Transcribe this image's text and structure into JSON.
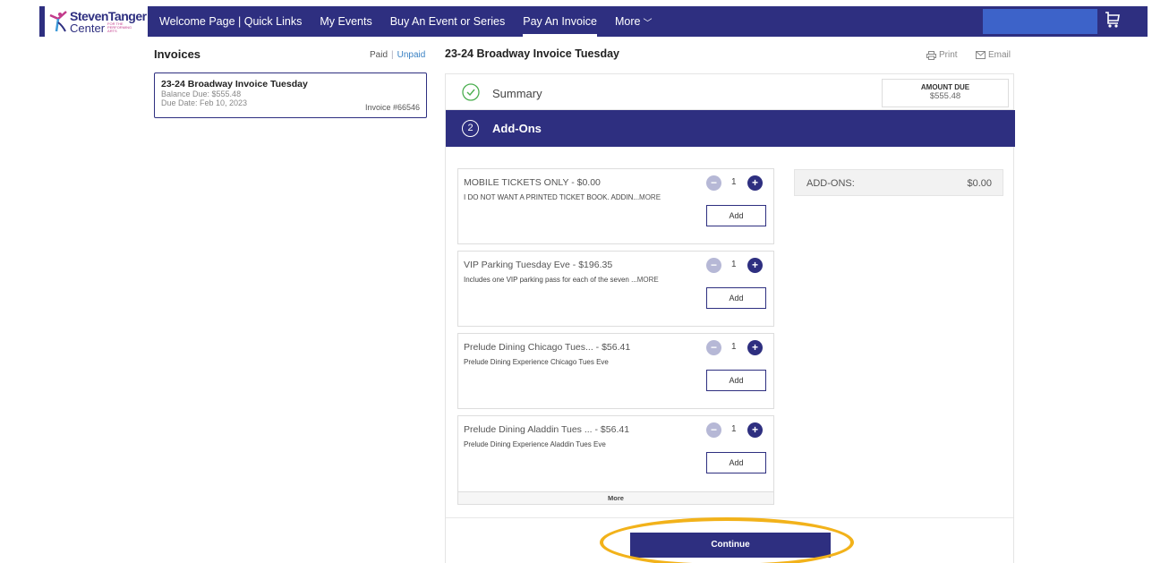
{
  "logo": {
    "line1": "StevenTanger",
    "line2": "Center",
    "tagline": "FOR THE PERFORMING ARTS"
  },
  "nav": {
    "items": [
      {
        "label": "Welcome Page | Quick Links"
      },
      {
        "label": "My Events"
      },
      {
        "label": "Buy An Event or Series"
      },
      {
        "label": "Pay An Invoice"
      },
      {
        "label": "More"
      }
    ],
    "active_index": 3,
    "colors": {
      "bar": "#2e2f80",
      "search": "#3d63c9"
    }
  },
  "left": {
    "title": "Invoices",
    "paid": "Paid",
    "unpaid": "Unpaid",
    "invoice": {
      "name": "23-24 Broadway Invoice Tuesday",
      "balance": "Balance Due: $555.48",
      "due_date": "Due Date: Feb 10, 2023",
      "number": "Invoice #66546"
    }
  },
  "main": {
    "title": "23-24 Broadway Invoice Tuesday",
    "print": "Print",
    "email": "Email",
    "summary_label": "Summary",
    "amount_due_label": "AMOUNT DUE",
    "amount_due_value": "$555.48",
    "step_number": "2",
    "addons_label": "Add-Ons",
    "addons": [
      {
        "title": "MOBILE TICKETS ONLY - $0.00",
        "desc": "I DO NOT WANT A PRINTED TICKET BOOK. ADDIN...",
        "more": "MORE",
        "qty": "1",
        "add": "Add"
      },
      {
        "title": "VIP Parking Tuesday Eve - $196.35",
        "desc": "Includes one VIP parking pass for each of the seven ...",
        "more": "MORE",
        "qty": "1",
        "add": "Add"
      },
      {
        "title": "Prelude Dining Chicago Tues... - $56.41",
        "desc": "Prelude Dining Experience Chicago Tues Eve",
        "more": "",
        "qty": "1",
        "add": "Add"
      },
      {
        "title": "Prelude Dining Aladdin Tues ... - $56.41",
        "desc": "Prelude Dining Experience Aladdin Tues Eve",
        "more": "",
        "qty": "1",
        "add": "Add"
      }
    ],
    "more_label": "More",
    "addons_total_label": "ADD-ONS:",
    "addons_total_value": "$0.00",
    "continue": "Continue",
    "highlight_color": "#f2b21a"
  }
}
